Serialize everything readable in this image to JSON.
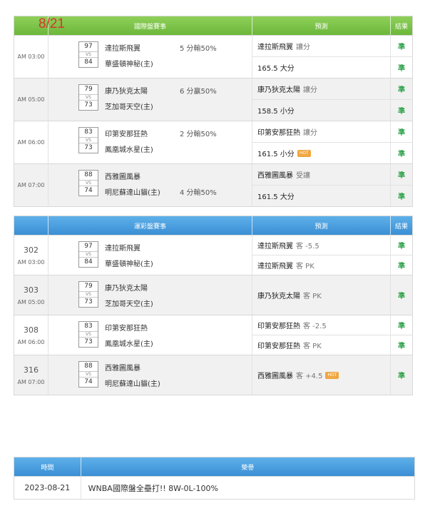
{
  "date_tag": "8/21",
  "intl": {
    "headers": {
      "match": "國際盤賽事",
      "pred": "預測",
      "res": "結果"
    },
    "games": [
      {
        "time": "AM 03:00",
        "score_a": "97",
        "score_b": "84",
        "vs": "VS",
        "team_a": "達拉斯飛翼",
        "team_b": "華盛頓神秘(主)",
        "spread": "5 分輸50%",
        "spread_row": "a",
        "preds": [
          {
            "text": "達拉斯飛翼",
            "note": "讓分",
            "result": "準"
          },
          {
            "text": "165.5 大分",
            "note": "",
            "result": "準"
          }
        ]
      },
      {
        "time": "AM 05:00",
        "score_a": "79",
        "score_b": "73",
        "vs": "VS",
        "team_a": "康乃狄克太陽",
        "team_b": "芝加哥天空(主)",
        "spread": "6 分贏50%",
        "spread_row": "a",
        "preds": [
          {
            "text": "康乃狄克太陽",
            "note": "讓分",
            "result": "準"
          },
          {
            "text": "158.5 小分",
            "note": "",
            "result": "準"
          }
        ]
      },
      {
        "time": "AM 06:00",
        "score_a": "83",
        "score_b": "73",
        "vs": "VS",
        "team_a": "印第安那狂熱",
        "team_b": "鳳凰城水星(主)",
        "spread": "2 分輸50%",
        "spread_row": "a",
        "preds": [
          {
            "text": "印第安那狂熱",
            "note": "讓分",
            "result": "準"
          },
          {
            "text": "161.5 小分",
            "note": "",
            "hot": "HOT",
            "result": "準"
          }
        ]
      },
      {
        "time": "AM 07:00",
        "score_a": "88",
        "score_b": "74",
        "vs": "VS",
        "team_a": "西雅圖風暴",
        "team_b": "明尼蘇達山貓(主)",
        "spread": "4 分輸50%",
        "spread_row": "b",
        "preds": [
          {
            "text": "西雅圖風暴",
            "note": "受讓",
            "result": "準"
          },
          {
            "text": "161.5 大分",
            "note": "",
            "result": "準"
          }
        ]
      }
    ]
  },
  "lottery": {
    "headers": {
      "match": "運彩盤賽事",
      "pred": "預測",
      "res": "結果"
    },
    "games": [
      {
        "num": "302",
        "time": "AM 03:00",
        "score_a": "97",
        "score_b": "84",
        "vs": "VS",
        "team_a": "達拉斯飛翼",
        "team_b": "華盛頓神秘(主)",
        "preds": [
          {
            "text": "達拉斯飛翼",
            "note": "客 -5.5",
            "result": "準"
          },
          {
            "text": "達拉斯飛翼",
            "note": "客 PK",
            "result": "準"
          }
        ]
      },
      {
        "num": "303",
        "time": "AM 05:00",
        "score_a": "79",
        "score_b": "73",
        "vs": "VS",
        "team_a": "康乃狄克太陽",
        "team_b": "芝加哥天空(主)",
        "preds": [
          {
            "text": "康乃狄克太陽",
            "note": "客 PK",
            "result": "準"
          }
        ]
      },
      {
        "num": "308",
        "time": "AM 06:00",
        "score_a": "83",
        "score_b": "73",
        "vs": "VS",
        "team_a": "印第安那狂熱",
        "team_b": "鳳凰城水星(主)",
        "preds": [
          {
            "text": "印第安那狂熱",
            "note": "客 -2.5",
            "result": "準"
          },
          {
            "text": "印第安那狂熱",
            "note": "客 PK",
            "result": "準"
          }
        ]
      },
      {
        "num": "316",
        "time": "AM 07:00",
        "score_a": "88",
        "score_b": "74",
        "vs": "VS",
        "team_a": "西雅圖風暴",
        "team_b": "明尼蘇達山貓(主)",
        "preds": [
          {
            "text": "西雅圖風暴",
            "note": "客 +4.5",
            "hot": "HOT",
            "result": "準"
          }
        ]
      }
    ]
  },
  "honor": {
    "headers": {
      "time": "時間",
      "honor": "榮譽"
    },
    "rows": [
      {
        "date": "2023-08-21",
        "text": "WNBA國際盤全壘打!! 8W-0L-100%"
      }
    ]
  }
}
